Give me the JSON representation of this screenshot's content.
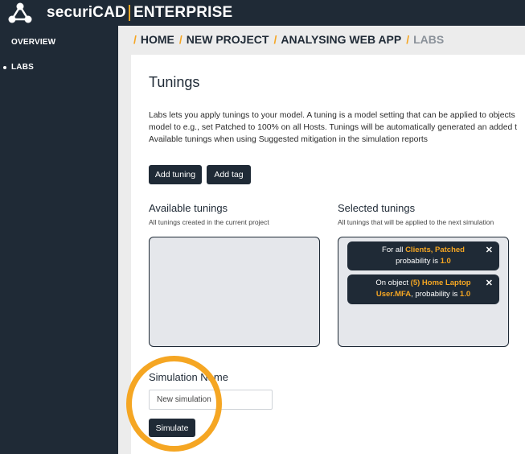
{
  "app": {
    "brand_name": "securiCAD",
    "brand_suffix": "ENTERPRISE",
    "logo_icon": "network-nodes-icon"
  },
  "sidebar": {
    "items": [
      {
        "label": "OVERVIEW"
      },
      {
        "label": "LABS",
        "active": true
      }
    ]
  },
  "breadcrumb": {
    "items": [
      "HOME",
      "NEW PROJECT",
      "ANALYSING WEB APP",
      "LABS"
    ]
  },
  "page": {
    "title": "Tunings",
    "description_lines": [
      "Labs lets you apply tunings to your model. A tuning is a model setting that can be applied to objects",
      "model to e.g., set Patched to 100% on all Hosts. Tunings will be automatically generated an added t",
      "Available tunings when using Suggested mitigation in the simulation reports"
    ]
  },
  "buttons": {
    "add_tuning": "Add tuning",
    "add_tag": "Add tag",
    "simulate": "Simulate"
  },
  "available": {
    "title": "Available tunings",
    "subtitle": "All tunings created in the current project"
  },
  "selected": {
    "title": "Selected tunings",
    "subtitle": "All tunings that will be applied to the next simulation",
    "tunings": [
      {
        "prefix": "For all ",
        "target": "Clients, Patched",
        "mid": "probability is ",
        "value": "1.0"
      },
      {
        "prefix": "On object ",
        "target": "(5) Home Laptop User.MFA",
        "mid": ", probability is ",
        "value": "1.0"
      }
    ]
  },
  "simulation": {
    "label": "Simulation Name",
    "value": "New simulation"
  },
  "colors": {
    "navy": "#1f2a36",
    "accent": "#f5a623",
    "background": "#ececec"
  }
}
